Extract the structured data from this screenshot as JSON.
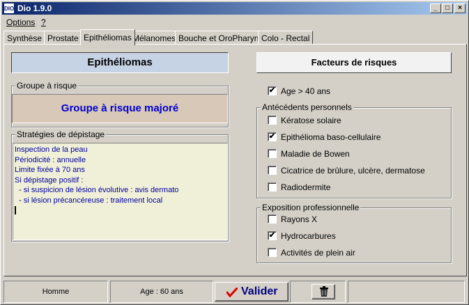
{
  "window": {
    "icon_text": "DIO",
    "title": "Dio 1.9.0"
  },
  "title_buttons": {
    "minimize": "_",
    "maximize": "□",
    "close": "×"
  },
  "menu": {
    "options": "Options",
    "help": "?"
  },
  "tabs": [
    "Synthèse",
    "Prostate",
    "Epithéliomas",
    "Mélanomes",
    "Bouche et OroPharynx",
    "Colo - Rectal"
  ],
  "active_tab": "Epithéliomas",
  "left": {
    "header": "Epithéliomas",
    "risk_group_legend": "Groupe à risque",
    "risk_group_value": "Groupe à risque majoré",
    "strategies_legend": "Stratégies de dépistage",
    "strategies_lines": [
      "Inspection de la peau",
      "Périodicité : annuelle",
      "Limite fixée à 70 ans",
      "Si dépistage positif :",
      "  - si suspicion de lésion évolutive : avis dermato",
      "  - si lésion précancéreuse : traitement local"
    ]
  },
  "right": {
    "header": "Facteurs de risques",
    "age_check": {
      "label": "Age > 40 ans",
      "checked": true
    },
    "personal_legend": "Antécédents personnels",
    "personal_items": [
      {
        "label": "Kératose solaire",
        "checked": false
      },
      {
        "label": "Epithélioma baso-cellulaire",
        "checked": true
      },
      {
        "label": "Maladie de Bowen",
        "checked": false
      },
      {
        "label": "Cicatrice de brûlure, ulcère, dermatose",
        "checked": false
      },
      {
        "label": "Radiodermite",
        "checked": false
      }
    ],
    "professional_legend": "Exposition professionnelle",
    "professional_items": [
      {
        "label": "Rayons X",
        "checked": false
      },
      {
        "label": "Hydrocarbures",
        "checked": true
      },
      {
        "label": "Activités de plein air",
        "checked": false
      }
    ]
  },
  "status": {
    "sex": "Homme",
    "age": "Age : 60 ans",
    "validate_label": "Valider"
  },
  "colors": {
    "title_start": "#0a246a",
    "title_end": "#a6caf0",
    "risk_bg": "#d7c8b7",
    "risk_text": "#0000d0",
    "validate_check": "#e00000"
  },
  "icons": {
    "validate": "checkmark-icon",
    "delete": "trash-icon"
  }
}
